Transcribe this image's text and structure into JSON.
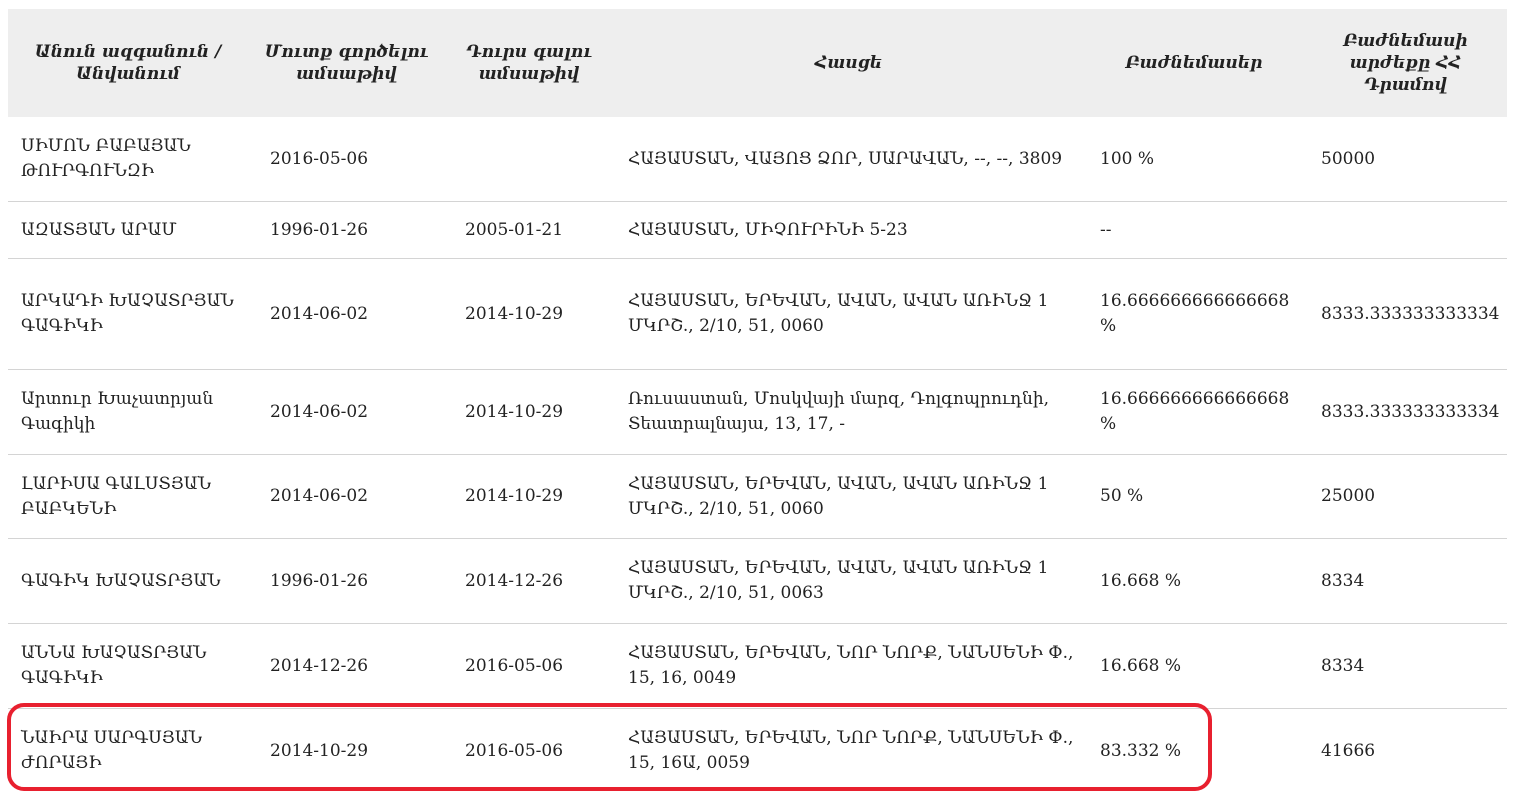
{
  "table": {
    "headers": [
      "Անուն ազգանուն / Անվանում",
      "Մուտք գործելու ամսաթիվ",
      "Դուրս գալու ամսաթիվ",
      "Հասցե",
      "Բաժնեմասեր",
      "Բաժնեմասի արժեքը ՀՀ Դրամով"
    ],
    "rows": [
      {
        "name": "ՍԻՄՈՆ ԲԱԲԱՅԱՆ ԹՈՒՐԳՈՒՆԶԻ",
        "entry_date": "2016-05-06",
        "exit_date": "",
        "address": "ՀԱՅԱՍՏԱՆ, ՎԱՅՈՑ ՁՈՐ, ՍԱՐԱՎԱՆ, --, --, 3809",
        "share": "100 %",
        "value": "50000"
      },
      {
        "name": "ԱԶԱՏՅԱՆ ԱՐԱՄ",
        "entry_date": "1996-01-26",
        "exit_date": "2005-01-21",
        "address": "ՀԱՅԱՍՏԱՆ, ՄԻՉՈՒՐԻՆԻ 5-23",
        "share": "--",
        "value": ""
      },
      {
        "name": "ԱՐԿԱԴԻ ԽԱՉԱՏՐՅԱՆ ԳԱԳԻԿԻ",
        "entry_date": "2014-06-02",
        "exit_date": "2014-10-29",
        "address": "ՀԱՅԱՍՏԱՆ, ԵՐԵՎԱՆ, ԱՎԱՆ, ԱՎԱՆ ԱՌԻՆՋ 1 ՄԿՐՇ., 2/10, 51, 0060",
        "share": "16.666666666666668 %",
        "value": "8333.333333333334"
      },
      {
        "name": "Արտուր Խաչատրյան Գագիկի",
        "entry_date": "2014-06-02",
        "exit_date": "2014-10-29",
        "address": "Ռուսաստան, Մոսկվայի մարզ, Դոլգոպրուդնի, Տեատրալնայա, 13, 17, -",
        "share": "16.666666666666668 %",
        "value": "8333.333333333334"
      },
      {
        "name": "ԼԱՐԻՍԱ ԳԱԼՍՏՅԱՆ ԲԱԲԿԵՆԻ",
        "entry_date": "2014-06-02",
        "exit_date": "2014-10-29",
        "address": "ՀԱՅԱՍՏԱՆ, ԵՐԵՎԱՆ, ԱՎԱՆ, ԱՎԱՆ ԱՌԻՆՋ 1 ՄԿՐՇ., 2/10, 51, 0060",
        "share": "50 %",
        "value": "25000"
      },
      {
        "name": "ԳԱԳԻԿ ԽԱՉԱՏՐՅԱՆ",
        "entry_date": "1996-01-26",
        "exit_date": "2014-12-26",
        "address": "ՀԱՅԱՍՏԱՆ, ԵՐԵՎԱՆ, ԱՎԱՆ, ԱՎԱՆ ԱՌԻՆՋ 1 ՄԿՐՇ., 2/10, 51, 0063",
        "share": "16.668 %",
        "value": "8334"
      },
      {
        "name": "ԱՆՆԱ ԽԱՉԱՏՐՅԱՆ ԳԱԳԻԿԻ",
        "entry_date": "2014-12-26",
        "exit_date": "2016-05-06",
        "address": "ՀԱՅԱՍՏԱՆ, ԵՐԵՎԱՆ, ՆՈՐ ՆՈՐՔ, ՆԱՆՍԵՆԻ Փ., 15, 16, 0049",
        "share": "16.668 %",
        "value": "8334"
      },
      {
        "name": "ՆԱԻՐԱ ՍԱՐԳՍՅԱՆ ԺՈՐԱՅԻ",
        "entry_date": "2014-10-29",
        "exit_date": "2016-05-06",
        "address": "ՀԱՅԱՍՏԱՆ, ԵՐԵՎԱՆ, ՆՈՐ ՆՈՐՔ, ՆԱՆՍԵՆԻ Փ., 15, 16Ա, 0059",
        "share": "83.332 %",
        "value": "41666"
      }
    ]
  },
  "highlight": {
    "row_index": 7,
    "color": "#e8202f"
  }
}
